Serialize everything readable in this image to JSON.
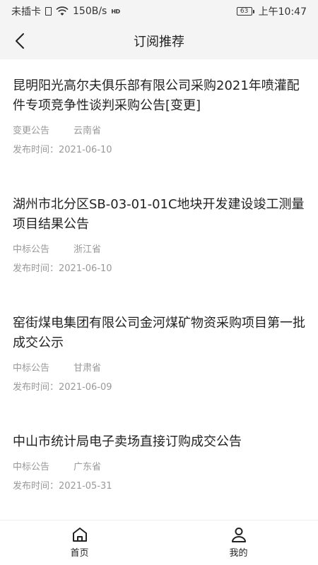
{
  "status_bar": {
    "carrier": "未插卡",
    "speed": "150B/s",
    "hd": "HD",
    "battery": "63",
    "time": "上午10:47"
  },
  "header": {
    "title": "订阅推荐",
    "back_icon": "chevron-left-icon"
  },
  "items": [
    {
      "title": "昆明阳光高尔夫俱乐部有限公司采购2021年喷灌配件专项竞争性谈判采购公告[变更]",
      "type": "变更公告",
      "region": "云南省",
      "date": "发布时间：2021-06-10"
    },
    {
      "title": "湖州市北分区SB-03-01-01C地块开发建设竣工测量项目结果公告",
      "type": "中标公告",
      "region": "浙江省",
      "date": "发布时间：2021-06-10"
    },
    {
      "title": "窑街煤电集团有限公司金河煤矿物资采购项目第一批成交公示",
      "type": "中标公告",
      "region": "甘肃省",
      "date": "发布时间：2021-06-09"
    },
    {
      "title": "中山市统计局电子卖场直接订购成交公告",
      "type": "中标公告",
      "region": "广东省",
      "date": "发布时间：2021-05-31"
    }
  ],
  "tabs": [
    {
      "label": "首页",
      "icon": "home-icon"
    },
    {
      "label": "我的",
      "icon": "user-icon"
    }
  ]
}
